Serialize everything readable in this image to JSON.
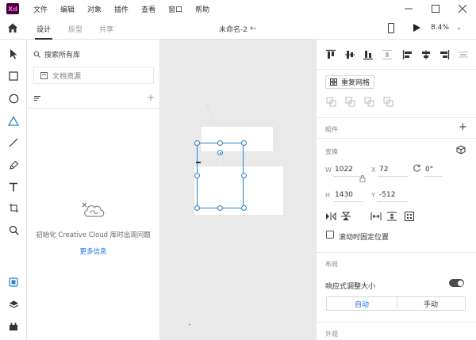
{
  "app": {
    "logo": "Xd",
    "menu": [
      "文件",
      "编辑",
      "对象",
      "插件",
      "查看",
      "窗口",
      "帮助"
    ],
    "window_controls": [
      "minimize-icon",
      "maximize-icon",
      "close-icon"
    ]
  },
  "toolbar": {
    "tabs": [
      {
        "label": "设计",
        "active": true
      },
      {
        "label": "原型",
        "active": false
      },
      {
        "label": "共享",
        "active": false
      }
    ],
    "document_title": "未命名-2 *",
    "zoom": "8.4%"
  },
  "tools": [
    "select-arrow-icon",
    "rectangle-icon",
    "ellipse-icon",
    "polygon-icon",
    "line-icon",
    "pen-icon",
    "text-icon",
    "artboard-icon",
    "zoom-icon",
    "assets-icon",
    "layers-icon",
    "plugins-icon"
  ],
  "library": {
    "search_placeholder": "搜索所有库",
    "document_assets": "文档资源",
    "cc_error": "初始化 Creative Cloud 库时出现问题",
    "more_info": "更多信息"
  },
  "inspector": {
    "repeat_grid": "重复网格",
    "components": "組件",
    "transform": "变换",
    "width_label": "W",
    "width": "1022",
    "x_label": "X",
    "x": "72",
    "rotation": "0°",
    "height_label": "H",
    "height": "1430",
    "y_label": "Y",
    "y": "-512",
    "fix_position": "滚动时固定位置",
    "layout": "布局",
    "responsive_resize": "响应式调整大小",
    "responsive_on": true,
    "resize_modes": [
      {
        "label": "自动",
        "active": true
      },
      {
        "label": "手动",
        "active": false
      }
    ],
    "appearance": "外观"
  },
  "colors": {
    "accent": "#1473e6",
    "selection": "#2d7fc6",
    "canvas": "#e9e9e9",
    "xd_brand": "#470137"
  }
}
